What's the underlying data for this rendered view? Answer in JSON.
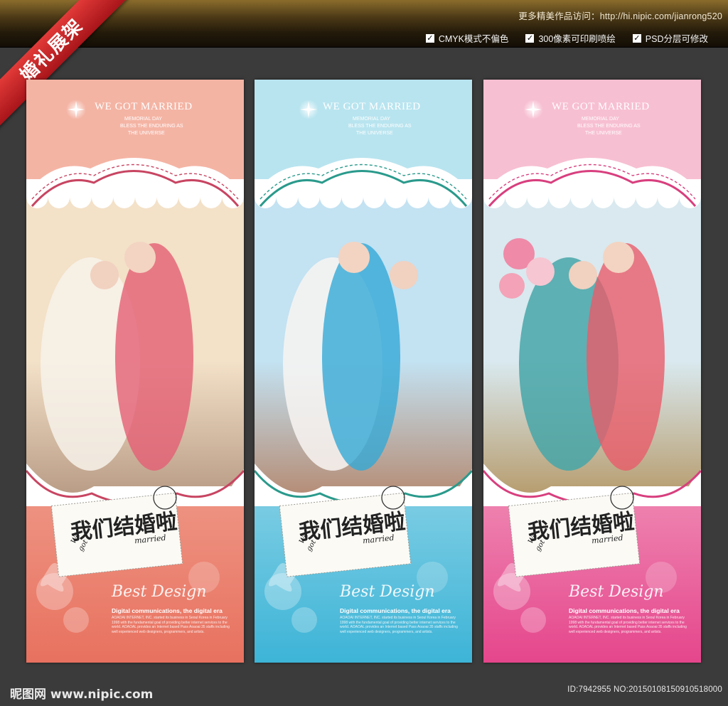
{
  "header": {
    "visit_text": "更多精美作品访问：http://hi.nipic.com/jianrong520",
    "features": [
      {
        "label": "CMYK模式不偏色",
        "checked": true
      },
      {
        "label": "300像素可印刷喷绘",
        "checked": true
      },
      {
        "label": "PSD分层可修改",
        "checked": true
      }
    ]
  },
  "ribbon": {
    "label": "婚礼展架",
    "color": "#c8221f"
  },
  "stands": [
    {
      "theme_top": "#f4b4a4",
      "theme_bottom": "#e8715f",
      "accent": "#c84562",
      "headline": "WE GOT MARRIED",
      "sub_lines": [
        "MEMORIAL DAY",
        "BLESS THE ENDURING AS",
        "THE UNIVERSE"
      ],
      "card_title": "我们结婚啦",
      "card_we": "We",
      "card_got": "got",
      "card_married": "married",
      "script": "Best Design",
      "tagline": "Digital communications, the digital era",
      "body": "AOAOAI INTERNET, INC. started its business in Seoul Korea in February 1998 with the fundamental goal of providing better internet services to the world. AOAOAL provides an Internet based Pass Aoaoai 35 staffs including well experienced web designers, programmers, and artists."
    },
    {
      "theme_top": "#b8e4ef",
      "theme_bottom": "#3db4d7",
      "accent": "#2a9a8c",
      "headline": "WE GOT MARRIED",
      "sub_lines": [
        "MEMORIAL DAY",
        "BLESS THE ENDURING AS",
        "THE UNIVERSE"
      ],
      "card_title": "我们结婚啦",
      "card_we": "We",
      "card_got": "got",
      "card_married": "married",
      "script": "Best Design",
      "tagline": "Digital communications, the digital era",
      "body": "AOAOAI INTERNET, INC. started its business in Seoul Korea in February 1998 with the fundamental goal of providing better internet services to the world. AOAOAL provides an Internet based Pass Aoaoai 35 staffs including well experienced web designers, programmers, and artists."
    },
    {
      "theme_top": "#f7bfd2",
      "theme_bottom": "#e5468c",
      "accent": "#d83f7e",
      "headline": "WE GOT MARRIED",
      "sub_lines": [
        "MEMORIAL DAY",
        "BLESS THE ENDURING AS",
        "THE UNIVERSE"
      ],
      "card_title": "我们结婚啦",
      "card_we": "We",
      "card_got": "got",
      "card_married": "married",
      "script": "Best Design",
      "tagline": "Digital communications, the digital era",
      "body": "AOAOAI INTERNET, INC. started its business in Seoul Korea in February 1998 with the fundamental goal of providing better internet services to the world. AOAOAL provides an Internet based Pass Aoaoai 35 staffs including well experienced web designers, programmers, and artists."
    }
  ],
  "footer": {
    "logo": "昵图网 www.nipic.com",
    "id_text": "ID:7942955 NO:20150108150910518000"
  }
}
